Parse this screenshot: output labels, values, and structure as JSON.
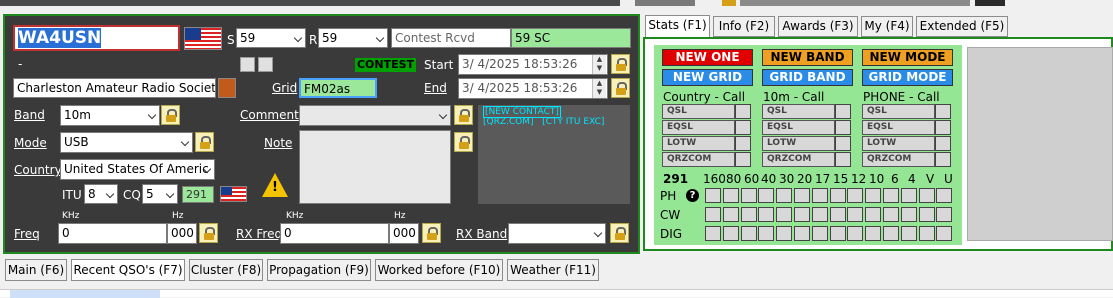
{
  "colors": {
    "panel_bg": "#3a3a3a",
    "panel_border": "#1e8a1e",
    "stats_bg": "#94e694",
    "contest_bg": "#00a000",
    "new_one": "#e00000",
    "new_band": "#f0a020",
    "new_grid": "#2a8ce6"
  },
  "qso": {
    "callsign": "WA4USN",
    "s_label": "S",
    "s_value": "59",
    "r_label": "R",
    "r_value": "59",
    "contest_rcvd_placeholder": "Contest Rcvd",
    "contest_rcvd_value": "59 SC",
    "dash": "-",
    "contest_badge": "CONTEST",
    "start_label": "Start",
    "start_value": "3/  4/2025 18:53:26",
    "end_label": "End",
    "end_value": "3/  4/2025 18:53:26",
    "name_value": "Charleston Amateur Radio Society Ir",
    "grid_label": "Grid",
    "grid_value": "FM02as",
    "band_label": "Band",
    "band_value": "10m",
    "mode_label": "Mode",
    "mode_value": "USB",
    "country_label": "Country",
    "country_value": "United States Of Americ",
    "itu_label": "ITU",
    "itu_value": "8",
    "cq_label": "CQ",
    "cq_value": "5",
    "dxcc_value": "291",
    "comment_label": "Comment",
    "note_label": "Note",
    "info_links": [
      "[NEW CONTACT]",
      "[QRZ.COM]",
      "[CTY ITU EXC]"
    ],
    "freq_label": "Freq",
    "khz": "KHz",
    "hz": "Hz",
    "freq_khz": "0",
    "freq_hz": "000",
    "rxfreq_label": "RX Freq",
    "rxfreq_khz": "0",
    "rxfreq_hz": "000",
    "rxband_label": "RX Band"
  },
  "tabs": [
    "Stats (F1)",
    "Info (F2)",
    "Awards (F3)",
    "My (F4)",
    "Extended (F5)"
  ],
  "stats": {
    "buttons": [
      "NEW ONE",
      "NEW BAND",
      "NEW MODE",
      "NEW GRID",
      "GRID BAND",
      "GRID MODE"
    ],
    "columns": [
      "Country - Call",
      "10m - Call",
      "PHONE - Call"
    ],
    "services": [
      "QSL",
      "EQSL",
      "LOTW",
      "QRZCOM"
    ],
    "count": "291",
    "bands": [
      "160",
      "80",
      "60",
      "40",
      "30",
      "20",
      "17",
      "15",
      "12",
      "10",
      "6",
      "4",
      "V",
      "U"
    ],
    "modes": [
      "PH",
      "CW",
      "DIG"
    ],
    "help": "?"
  },
  "bottom_tabs": [
    "Main (F6)",
    "Recent QSO's (F7)",
    "Cluster (F8)",
    "Propagation (F9)",
    "Worked before (F10)",
    "Weather (F11)"
  ]
}
